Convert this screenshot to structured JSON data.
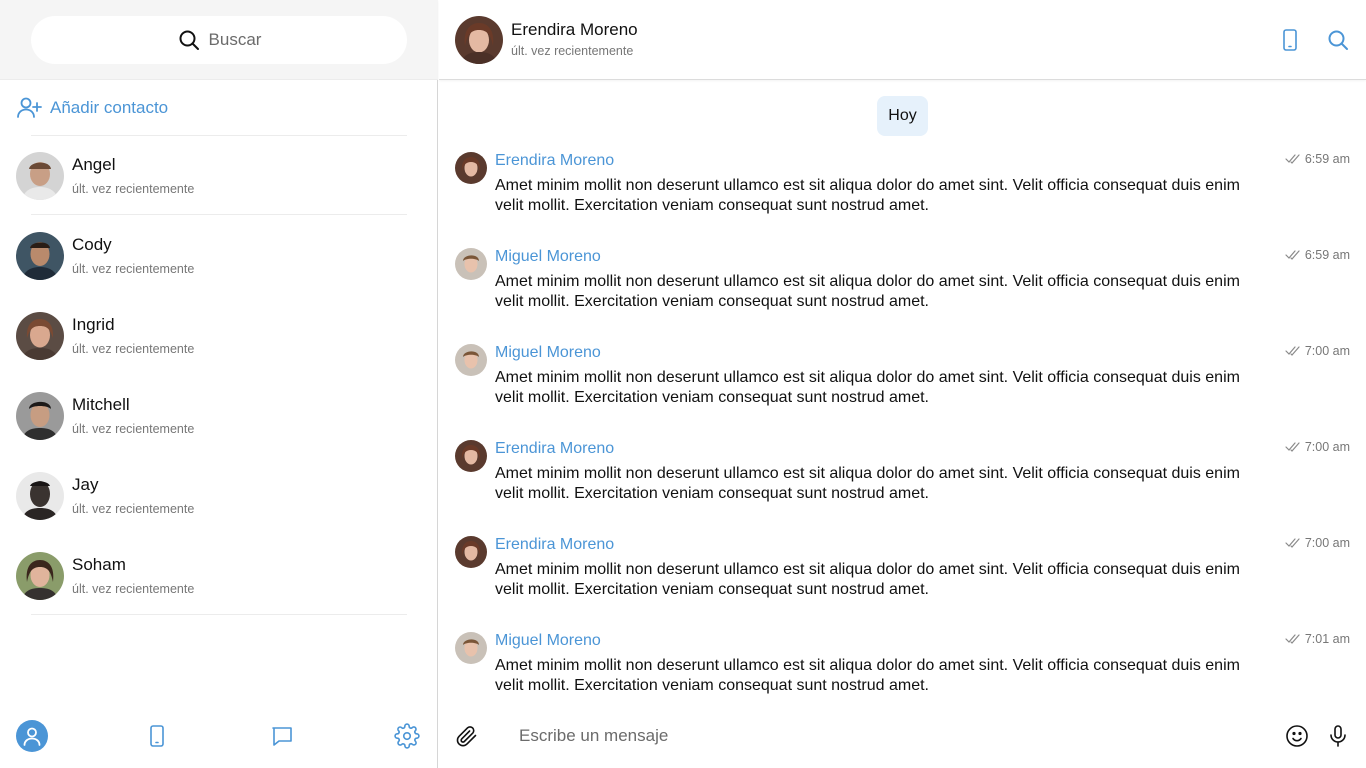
{
  "colors": {
    "accent": "#4b95d6",
    "date_pill_bg": "#e6f1fb",
    "sidebar_top_bg": "#f5f5f5"
  },
  "sidebar": {
    "search": {
      "placeholder": "Buscar",
      "icon": "search-icon"
    },
    "add_contact": {
      "label": "Añadir contacto",
      "icon": "add-user-icon"
    },
    "contacts": [
      {
        "name": "Angel",
        "status": "últ. vez recientemente"
      },
      {
        "name": "Cody",
        "status": "últ. vez recientemente"
      },
      {
        "name": "Ingrid",
        "status": "últ. vez recientemente"
      },
      {
        "name": "Mitchell",
        "status": "últ. vez recientemente"
      },
      {
        "name": "Jay",
        "status": "últ. vez recientemente"
      },
      {
        "name": "Soham",
        "status": "últ. vez recientemente"
      }
    ],
    "bottom_nav": [
      {
        "icon": "user-icon",
        "active": true
      },
      {
        "icon": "phone-icon",
        "active": false
      },
      {
        "icon": "chat-icon",
        "active": false
      },
      {
        "icon": "gear-icon",
        "active": false
      }
    ]
  },
  "chat": {
    "header": {
      "name": "Erendira Moreno",
      "status": "últ. vez recientemente",
      "icons": [
        "phone-icon",
        "search-icon"
      ]
    },
    "date_label": "Hoy",
    "messages": [
      {
        "sender": "Erendira Moreno",
        "time": "6:59 am",
        "text": "Amet minim mollit non deserunt ullamco est sit aliqua dolor do amet sint. Velit officia consequat duis enim velit mollit. Exercitation veniam consequat sunt nostrud amet."
      },
      {
        "sender": "Miguel Moreno",
        "time": "6:59 am",
        "text": "Amet minim mollit non deserunt ullamco est sit aliqua dolor do amet sint. Velit officia consequat duis enim velit mollit. Exercitation veniam consequat sunt nostrud amet."
      },
      {
        "sender": "Miguel Moreno",
        "time": "7:00 am",
        "text": "Amet minim mollit non deserunt ullamco est sit aliqua dolor do amet sint. Velit officia consequat duis enim velit mollit. Exercitation veniam consequat sunt nostrud amet."
      },
      {
        "sender": "Erendira Moreno",
        "time": "7:00 am",
        "text": "Amet minim mollit non deserunt ullamco est sit aliqua dolor do amet sint. Velit officia consequat duis enim velit mollit. Exercitation veniam consequat sunt nostrud amet."
      },
      {
        "sender": "Erendira Moreno",
        "time": "7:00 am",
        "text": "Amet minim mollit non deserunt ullamco est sit aliqua dolor do amet sint. Velit officia consequat duis enim velit mollit. Exercitation veniam consequat sunt nostrud amet."
      },
      {
        "sender": "Miguel Moreno",
        "time": "7:01 am",
        "text": "Amet minim mollit non deserunt ullamco est sit aliqua dolor do amet sint. Velit officia consequat duis enim velit mollit. Exercitation veniam consequat sunt nostrud amet."
      }
    ],
    "composer": {
      "placeholder": "Escribe un mensaje"
    }
  }
}
